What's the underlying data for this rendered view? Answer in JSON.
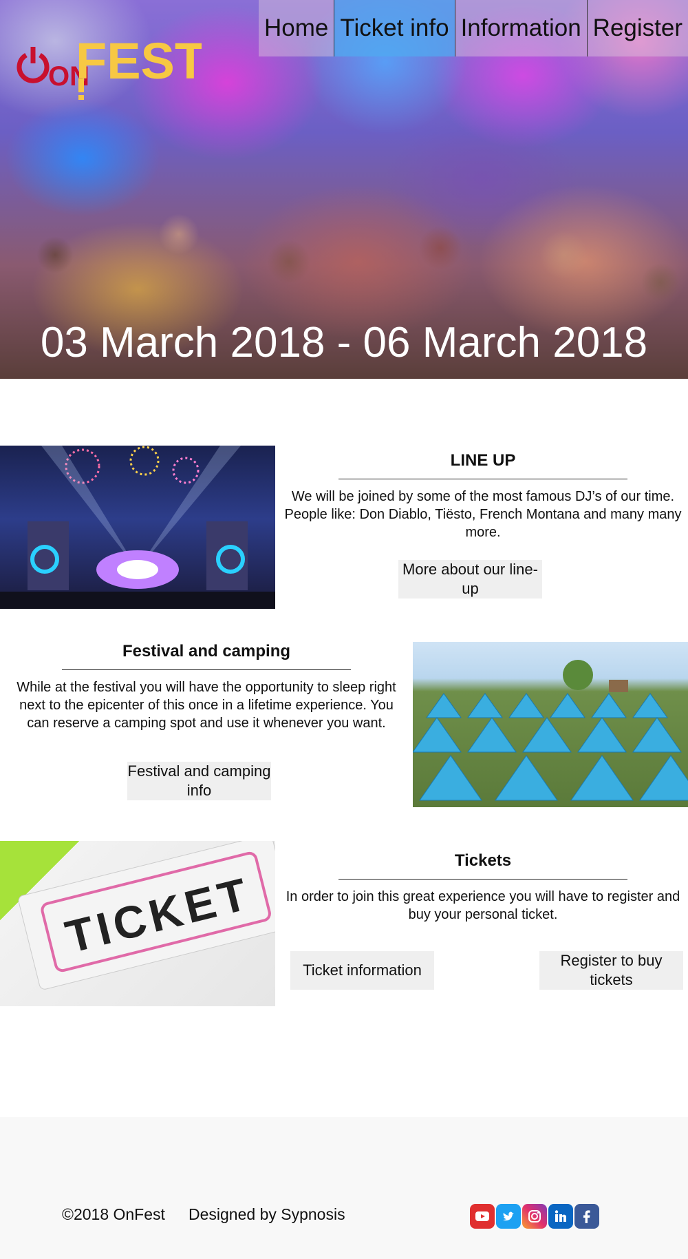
{
  "nav": {
    "items": [
      {
        "label": "Home"
      },
      {
        "label": "Ticket info"
      },
      {
        "label": "Information"
      },
      {
        "label": "Register"
      }
    ],
    "active_index": 1
  },
  "logo": {
    "text_on": "ON",
    "text_fest": "FEST"
  },
  "hero": {
    "date_range": "03 March 2018 - 06 March 2018"
  },
  "lineup": {
    "title": "LINE UP",
    "body": "We will be joined by some of the most famous DJ’s  of our time. People like: Don Diablo, Tiësto, French Montana and many many more.",
    "button": "More about our line-up"
  },
  "camping": {
    "title": "Festival and camping",
    "body": "While at the festival you will have the opportunity to sleep right next to the epicenter of this once in a lifetime experience. You can reserve a camping spot and use it whenever you want.",
    "button": "Festival and camping info"
  },
  "tickets": {
    "title": "Tickets",
    "body": "In order to join this great experience you will have to register and buy your personal ticket.",
    "button_info": "Ticket information",
    "button_register": "Register to buy tickets",
    "image_word": "TICKET"
  },
  "footer": {
    "copyright": "©2018 OnFest",
    "designed_by": "Designed by Sypnosis",
    "social": [
      {
        "name": "youtube-icon",
        "color": "#e02f2f"
      },
      {
        "name": "twitter-icon",
        "color": "#1da1f2"
      },
      {
        "name": "instagram-icon",
        "color": "#c13584"
      },
      {
        "name": "linkedin-icon",
        "color": "#0a66c2"
      },
      {
        "name": "facebook-icon",
        "color": "#3b5998"
      }
    ]
  },
  "colors": {
    "nav_active": "#50aaf0",
    "logo_red": "#c8102e",
    "logo_yellow": "#f7c843",
    "button_bg": "#efefef",
    "footer_bg": "#f8f8f8"
  }
}
